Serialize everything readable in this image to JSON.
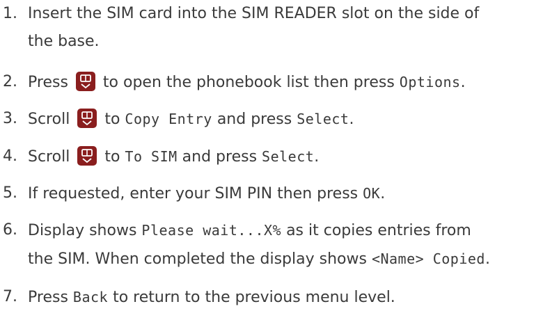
{
  "steps": [
    {
      "number": "1.",
      "line1": "Insert the SIM card into the SIM READER slot on the side of",
      "line2": "the base."
    },
    {
      "number": "2.",
      "pre": "Press",
      "icon": "phonebook-key-icon",
      "mid": "to open the phonebook list then press",
      "lcd1": "Options",
      "post": "."
    },
    {
      "number": "3.",
      "pre": "Scroll",
      "icon": "phonebook-key-icon",
      "mid": "to",
      "lcd1": "Copy Entry",
      "mid2": "and press",
      "lcd2": "Select",
      "post": "."
    },
    {
      "number": "4.",
      "pre": "Scroll",
      "icon": "phonebook-key-icon",
      "mid": "to",
      "lcd1": "To SIM",
      "mid2": "and press",
      "lcd2": "Select",
      "post": "."
    },
    {
      "number": "5.",
      "pre": "If requested, enter your SIM PIN then press",
      "lcd1": "OK",
      "post": "."
    },
    {
      "number": "6.",
      "pre": "Display shows",
      "lcd1": "Please wait...X%",
      "mid": "as it copies entries from",
      "line2_pre": "the SIM. When completed the display shows",
      "lcd2": "<Name> Copied",
      "post": "."
    },
    {
      "number": "7.",
      "pre": "Press",
      "lcd1": "Back",
      "mid": "to return to the previous menu level."
    }
  ],
  "colors": {
    "text": "#3a3a3a",
    "key_background": "#8a1e1e",
    "key_symbol": "#ffffff"
  }
}
